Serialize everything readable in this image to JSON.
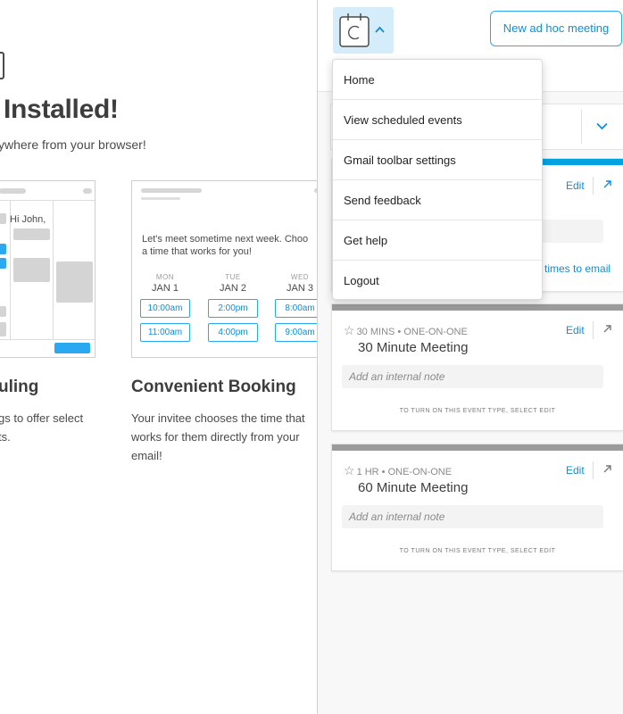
{
  "background": {
    "heading": "Installed!",
    "subheading": "ywhere from your browser!",
    "email": {
      "greeting": "Hi John,",
      "line1": "Let's meet sometime next week. Choo",
      "line2": "a time that works for you!",
      "days": [
        {
          "name": "MON",
          "date": "JAN 1",
          "slots": [
            "10:00am",
            "11:00am"
          ]
        },
        {
          "name": "TUE",
          "date": "JAN 2",
          "slots": [
            "2:00pm",
            "4:00pm"
          ]
        },
        {
          "name": "WED",
          "date": "JAN 3",
          "slots": [
            "8:00am",
            "9:00am"
          ]
        }
      ]
    },
    "features": [
      {
        "title": "uling",
        "lines": [
          "gs to offer select",
          "ts."
        ]
      },
      {
        "title": "Convenient Booking",
        "lines": [
          "Your invitee chooses the time that",
          "works for them directly from your",
          "email!"
        ]
      }
    ]
  },
  "panel": {
    "adhoc_button": "New ad hoc meeting",
    "partial_card": {
      "edit": "Edit",
      "link_text": "times to email"
    },
    "events": [
      {
        "meta": "30 MINS • ONE-ON-ONE",
        "name": "30 Minute Meeting",
        "edit": "Edit",
        "note_placeholder": "Add an internal note",
        "hint": "To turn on this event type, select Edit",
        "stripe_color": "#9b9b9b"
      },
      {
        "meta": "1 HR • ONE-ON-ONE",
        "name": "60 Minute Meeting",
        "edit": "Edit",
        "note_placeholder": "Add an internal note",
        "hint": "To turn on this event type, select Edit",
        "stripe_color": "#9b9b9b"
      }
    ]
  },
  "menu": {
    "items": [
      "Home",
      "View scheduled events",
      "Gmail toolbar settings",
      "Send feedback",
      "Get help",
      "Logout"
    ]
  },
  "colors": {
    "accent": "#0a8fdd",
    "accent_light": "#d5ecfb",
    "cyan_stripe": "#00a2e0"
  }
}
